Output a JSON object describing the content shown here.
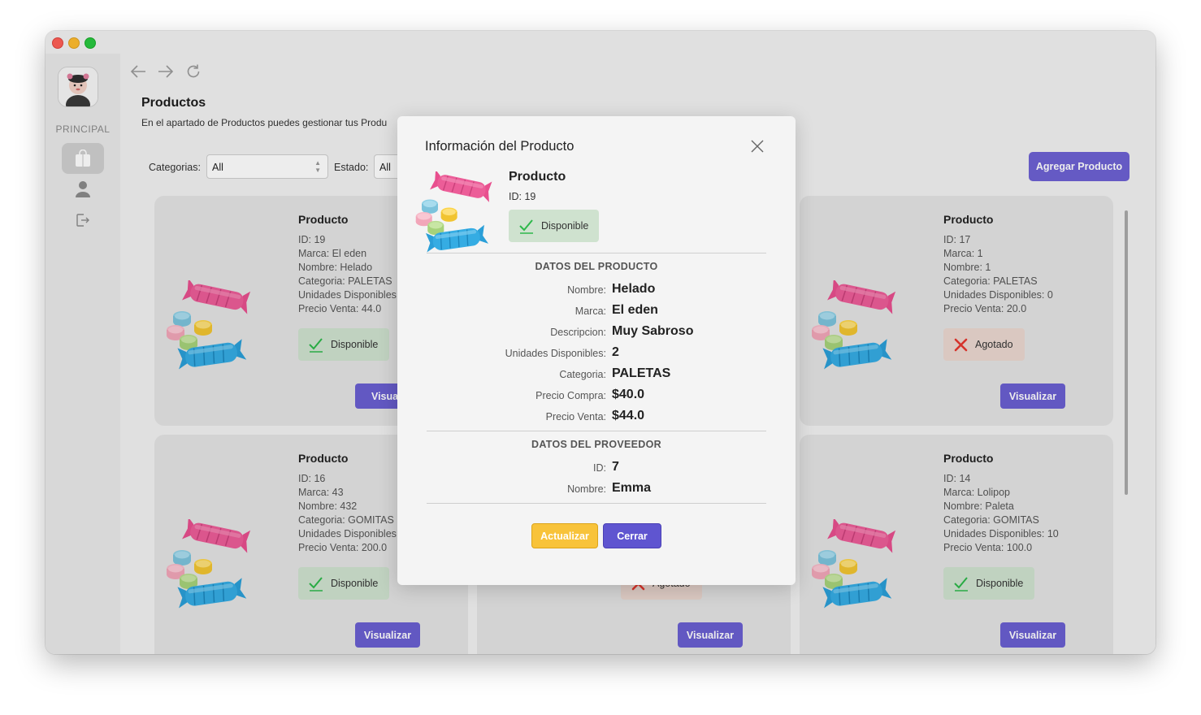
{
  "sidebar": {
    "section_label": "PRINCIPAL",
    "items": [
      {
        "name": "products",
        "icon": "store-icon",
        "active": true
      },
      {
        "name": "users",
        "icon": "user-icon",
        "active": false
      },
      {
        "name": "logout",
        "icon": "logout-icon",
        "active": false
      }
    ]
  },
  "page": {
    "title": "Productos",
    "subtitle": "En el apartado de Productos puedes gestionar tus Produ"
  },
  "filters": {
    "category_label": "Categorias:",
    "category_value": "All",
    "status_label": "Estado:",
    "status_value": "All"
  },
  "add_button": "Agregar Producto",
  "product_cards": [
    {
      "title": "Producto",
      "id": "ID: 19",
      "marca": "Marca: El eden",
      "nombre": "Nombre: Helado",
      "categoria": "Categoria: PALETAS",
      "unidades": "Unidades Disponibles",
      "precio": "Precio Venta: 44.0",
      "status": "Disponible",
      "button": "Visuali"
    },
    {
      "title": "Producto",
      "id": "ID: 17",
      "marca": "Marca: 1",
      "nombre": "Nombre: 1",
      "categoria": "Categoria: PALETAS",
      "unidades": "Unidades Disponibles: 0",
      "precio": "Precio Venta: 20.0",
      "status": "Agotado",
      "button": "Visualizar"
    },
    {
      "title": "Producto",
      "id": "ID: 16",
      "marca": "Marca: 43",
      "nombre": "Nombre: 432",
      "categoria": "Categoria: GOMITAS",
      "unidades": "Unidades Disponibles",
      "precio": "Precio Venta: 200.0",
      "status": "Disponible",
      "button": "Visualizar"
    },
    {
      "title": "Producto",
      "id": "ID: 14",
      "marca": "Marca: Lolipop",
      "nombre": "Nombre: Paleta",
      "categoria": "Categoria: GOMITAS",
      "unidades": "Unidades Disponibles: 10",
      "precio": "Precio Venta: 100.0",
      "status": "Disponible",
      "button": "Visualizar"
    }
  ],
  "hidden_card": {
    "status": "Agotado",
    "button": "Visualizar"
  },
  "modal": {
    "title": "Información del Producto",
    "product_label": "Producto",
    "product_id": "ID: 19",
    "status": "Disponible",
    "product_section": "DATOS DEL PRODUCTO",
    "product_fields": [
      {
        "label": "Nombre:",
        "value": "Helado"
      },
      {
        "label": "Marca:",
        "value": "El eden"
      },
      {
        "label": "Descripcion:",
        "value": "Muy Sabroso"
      },
      {
        "label": "Unidades Disponibles:",
        "value": "2"
      },
      {
        "label": "Categoria:",
        "value": "PALETAS"
      },
      {
        "label": "Precio Compra:",
        "value": "$40.0"
      },
      {
        "label": "Precio Venta:",
        "value": "$44.0"
      }
    ],
    "supplier_section": "DATOS DEL PROVEEDOR",
    "supplier_fields": [
      {
        "label": "ID:",
        "value": "7"
      },
      {
        "label": "Nombre:",
        "value": "Emma"
      }
    ],
    "update_button": "Actualizar",
    "close_button": "Cerrar"
  },
  "colors": {
    "accent": "#6d61d3",
    "update": "#f8c33a",
    "available_bg": "#cfe2cf",
    "soldout_bg": "#ebd8d0"
  }
}
